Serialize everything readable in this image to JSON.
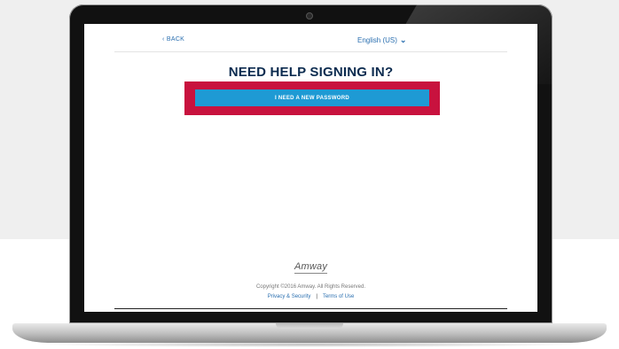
{
  "header": {
    "back_label": "BACK",
    "language_label": "English (US)"
  },
  "main": {
    "title": "NEED HELP SIGNING IN?",
    "new_password_button": "I NEED A NEW PASSWORD"
  },
  "footer": {
    "logo_text": "Amway",
    "copyright": "Copyright ©2016 Amway. All Rights Reserved.",
    "privacy_link": "Privacy & Security",
    "separator": "|",
    "terms_link": "Terms of Use"
  },
  "colors": {
    "title": "#0c2b4f",
    "button": "#1e9ad4",
    "highlight": "#c8123e",
    "link": "#2a6fb0"
  },
  "icons": {
    "back": "chevron-left-icon",
    "language": "chevron-down-icon"
  }
}
